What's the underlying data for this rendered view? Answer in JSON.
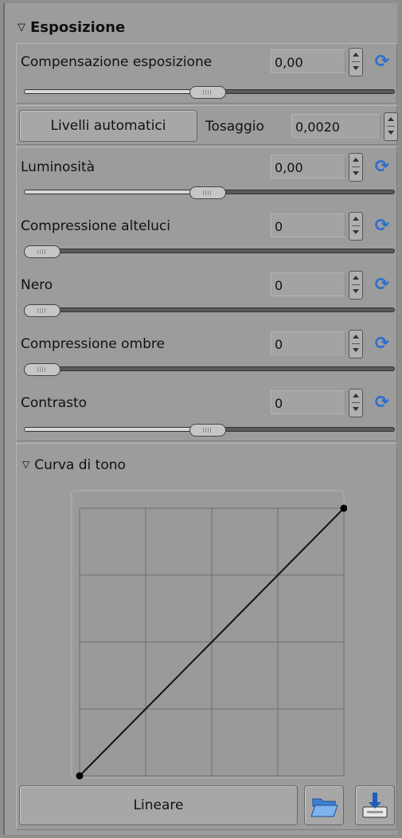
{
  "exposure": {
    "title": "Esposizione",
    "compensation": {
      "label": "Compensazione esposizione",
      "value": "0,00",
      "slider": 0.5
    },
    "auto_levels_label": "Livelli automatici",
    "clip": {
      "label": "Tosaggio",
      "value": "0,0020"
    },
    "sliders": [
      {
        "label": "Luminosità",
        "value": "0,00",
        "slider": 0.5
      },
      {
        "label": "Compressione alteluci",
        "value": "0",
        "slider": 0.0
      },
      {
        "label": "Nero",
        "value": "0",
        "slider": 0.0
      },
      {
        "label": "Compressione ombre",
        "value": "0",
        "slider": 0.0
      },
      {
        "label": "Contrasto",
        "value": "0",
        "slider": 0.5
      }
    ]
  },
  "tone_curve": {
    "title": "Curva di tono",
    "curve_type": "Lineare",
    "points": [
      [
        0,
        0
      ],
      [
        1,
        1
      ]
    ],
    "grid_divisions": 4,
    "icons": {
      "open": "folder-open-icon",
      "save": "save-icon",
      "reset": "reset-icon"
    },
    "accent": "#2b6fcf"
  }
}
